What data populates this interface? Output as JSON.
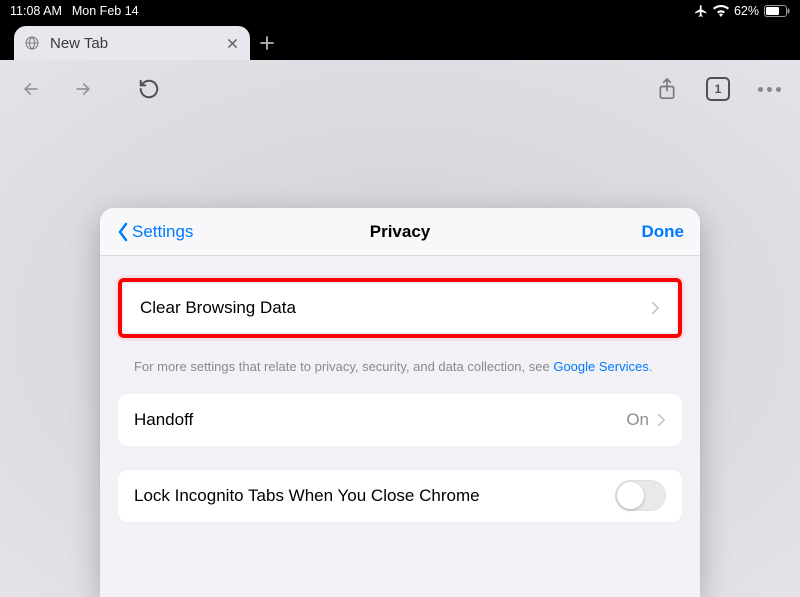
{
  "status": {
    "time": "11:08 AM",
    "date": "Mon Feb 14",
    "battery_pct": "62%"
  },
  "browser": {
    "tab_label": "New Tab",
    "tab_count": "1"
  },
  "sheet": {
    "back_label": "Settings",
    "title": "Privacy",
    "done_label": "Done",
    "clear_browsing": "Clear Browsing Data",
    "footnote_text": "For more settings that relate to privacy, security, and data collection, see ",
    "footnote_link": "Google Services",
    "footnote_period": ".",
    "handoff_label": "Handoff",
    "handoff_value": "On",
    "lock_incognito_label": "Lock Incognito Tabs When You Close Chrome"
  }
}
